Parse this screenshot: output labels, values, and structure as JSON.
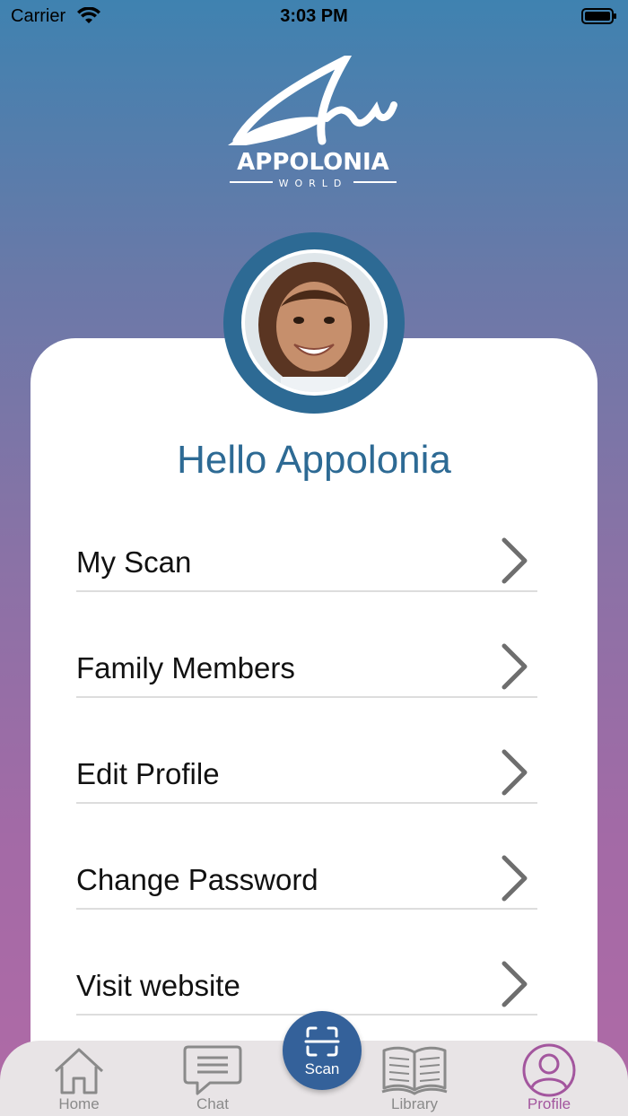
{
  "status_bar": {
    "carrier": "Carrier",
    "time": "3:03 PM"
  },
  "logo": {
    "wordmark": "APPOLONIA",
    "tagline": "WORLD"
  },
  "profile": {
    "greeting": "Hello Appolonia"
  },
  "menu": {
    "items": [
      {
        "label": "My Scan"
      },
      {
        "label": "Family Members"
      },
      {
        "label": "Edit Profile"
      },
      {
        "label": "Change Password"
      },
      {
        "label": "Visit website"
      }
    ]
  },
  "tabbar": {
    "home": "Home",
    "chat": "Chat",
    "scan": "Scan",
    "library": "Library",
    "profile": "Profile",
    "active": "profile"
  },
  "colors": {
    "accent": "#2d6a94",
    "active_tab": "#a3569e",
    "scan_button": "#34619a"
  }
}
